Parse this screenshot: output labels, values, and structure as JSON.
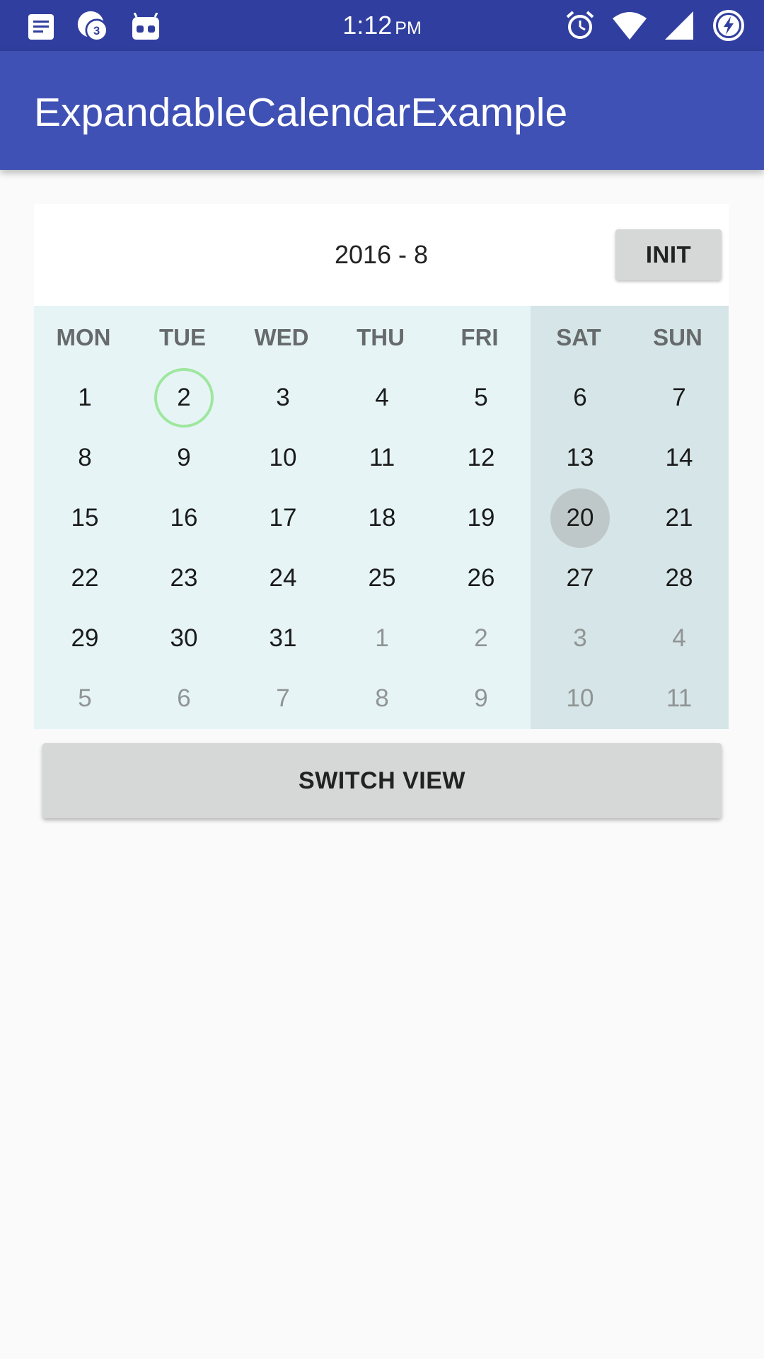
{
  "status_bar": {
    "time": "1:12",
    "ampm": "PM",
    "left_icons": [
      "notes-icon",
      "chat-badge-icon",
      "android-robot-icon"
    ],
    "badge_count": "3",
    "right_icons": [
      "alarm-icon",
      "wifi-icon",
      "signal-icon",
      "battery-charging-icon"
    ]
  },
  "app_bar": {
    "title": "ExpandableCalendarExample"
  },
  "calendar": {
    "month_label": "2016 - 8",
    "init_label": "INIT",
    "weekdays": [
      "MON",
      "TUE",
      "WED",
      "THU",
      "FRI",
      "SAT",
      "SUN"
    ],
    "weeks": [
      [
        {
          "d": "1"
        },
        {
          "d": "2",
          "today": true
        },
        {
          "d": "3"
        },
        {
          "d": "4"
        },
        {
          "d": "5"
        },
        {
          "d": "6"
        },
        {
          "d": "7"
        }
      ],
      [
        {
          "d": "8"
        },
        {
          "d": "9"
        },
        {
          "d": "10"
        },
        {
          "d": "11"
        },
        {
          "d": "12"
        },
        {
          "d": "13"
        },
        {
          "d": "14"
        }
      ],
      [
        {
          "d": "15"
        },
        {
          "d": "16"
        },
        {
          "d": "17"
        },
        {
          "d": "18"
        },
        {
          "d": "19"
        },
        {
          "d": "20",
          "selected": true
        },
        {
          "d": "21"
        }
      ],
      [
        {
          "d": "22"
        },
        {
          "d": "23"
        },
        {
          "d": "24"
        },
        {
          "d": "25"
        },
        {
          "d": "26"
        },
        {
          "d": "27"
        },
        {
          "d": "28"
        }
      ],
      [
        {
          "d": "29"
        },
        {
          "d": "30"
        },
        {
          "d": "31"
        },
        {
          "d": "1",
          "other": true
        },
        {
          "d": "2",
          "other": true
        },
        {
          "d": "3",
          "other": true
        },
        {
          "d": "4",
          "other": true
        }
      ],
      [
        {
          "d": "5",
          "other": true
        },
        {
          "d": "6",
          "other": true
        },
        {
          "d": "7",
          "other": true
        },
        {
          "d": "8",
          "other": true
        },
        {
          "d": "9",
          "other": true
        },
        {
          "d": "10",
          "other": true
        },
        {
          "d": "11",
          "other": true
        }
      ]
    ],
    "colors": {
      "weekday_bg": "#e6f4f6",
      "weekend_bg": "#d6e5e7",
      "today_ring": "#9ee79e",
      "selected_bg": "#bfc8c9"
    }
  },
  "switch_view_label": "SWITCH VIEW",
  "colors": {
    "status_bar": "#303f9f",
    "app_bar": "#3f51b5",
    "background": "#fafafa"
  }
}
